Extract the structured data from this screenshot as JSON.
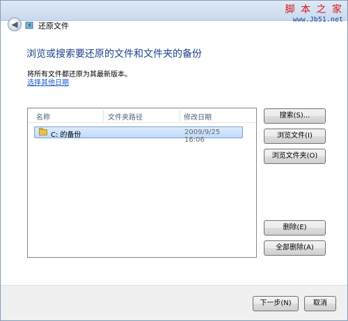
{
  "window": {
    "title": "还原文件"
  },
  "watermark": {
    "top": "脚 本 之 家",
    "url": "www.Jb51.net"
  },
  "main": {
    "heading": "浏览或搜索要还原的文件和文件夹的备份",
    "description": "将所有文件都还原为其最新版本。",
    "other_date_link": "选择其他日期"
  },
  "list": {
    "columns": [
      "名称",
      "文件夹路径",
      "修改日期"
    ],
    "rows": [
      {
        "name": "C: 的备份",
        "path": "",
        "date": "2009/9/25 16:06",
        "selected": true,
        "icon": "folder-icon"
      }
    ]
  },
  "buttons": {
    "search": "搜索(S)...",
    "browse_files": "浏览文件(I)",
    "browse_folders": "浏览文件夹(O)",
    "remove": "删除(E)",
    "remove_all": "全部删除(A)",
    "next": "下一步(N)",
    "cancel": "取消"
  },
  "colors": {
    "heading": "#1e3f8a",
    "link": "#1a56c8",
    "selection": "#c1dbfc"
  }
}
